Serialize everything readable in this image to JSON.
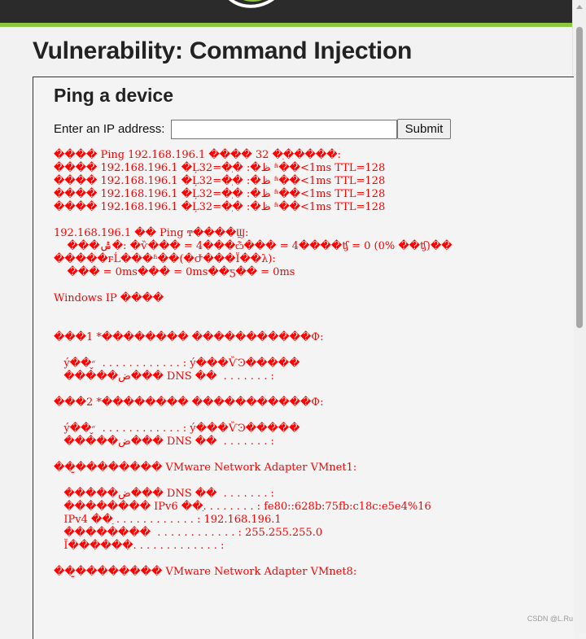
{
  "page": {
    "title": "Vulnerability: Command Injection",
    "section_title": "Ping a device",
    "ip_label": "Enter an IP address:",
    "ip_value": "",
    "submit_label": "Submit"
  },
  "colors": {
    "header_bg": "#2b2b2b",
    "accent_green": "#8dc63f",
    "output_text": "#ff0000"
  },
  "output_lines": [
    "���� Ping 192.168.196.1 ���� 32 �ֽ�����:",
    "���� 192.168.196.1 �Ļظ�: �ֽ�=32 ʱ��<1ms TTL=128",
    "���� 192.168.196.1 �Ļظ�: �ֽ�=32 ʱ��<1ms TTL=128",
    "���� 192.168.196.1 �Ļظ�: �ֽ�=32 ʱ��<1ms TTL=128",
    "���� 192.168.196.1 �Ļظ�: �ֽ�=32 ʱ��<1ms TTL=128",
    "",
    "192.168.196.1 �� Ping ͳ����Ϣ:",
    "    ���ݰ�: �ѷ��� = 4���ѽ��� = 4����ʧ = 0 (0% ��ʧ)��",
    "�����г̵Ĺ���ʱ��(�Ժ���Ϊ��λ):",
    "    ��� = 0ms��� = 0ms��ƽ�� = 0ms",
    "",
    "Windows IP ����",
    "",
    "",
    "���1 *�������� �����������Ф:",
    "",
    "   ý��״̬  . . . . . . . . . . . . : ý���ѶϿ�����",
    "   �����ض��� DNS ��  . . . . . . . :",
    "",
    "���2 *�������� �����������Ф:",
    "",
    "   ý��״̬  . . . . . . . . . . . . : ý���ѶϿ�����",
    "   �����ض��� DNS ��  . . . . . . . :",
    "",
    "��̫�������� VMware Network Adapter VMnet1:",
    "",
    "   �����ض��� DNS ��  . . . . . . . :",
    "   �������� IPv6 ��ַ. . . . . . . . : fe80::628b:75fb:c18c:e5e4%16",
    "   IPv4 ��ַ . . . . . . . . . . . . : 192.168.196.1",
    "   ��������  . . . . . . . . . . . . : 255.255.255.0",
    "   Ĭ������. . . . . . . . . . . . . :",
    "",
    "��̫�������� VMware Network Adapter VMnet8:"
  ],
  "watermark": "CSDN @L.Ru"
}
